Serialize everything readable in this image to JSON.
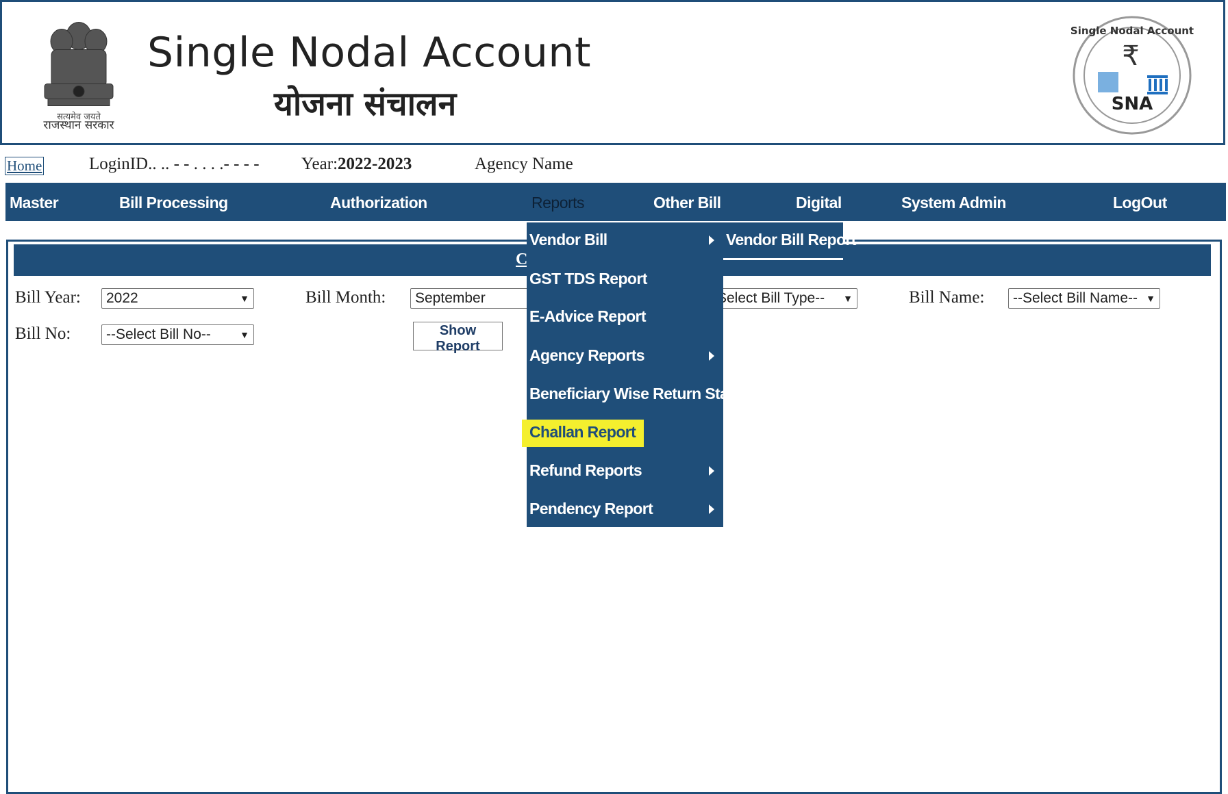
{
  "header": {
    "title_en": "Single Nodal Account",
    "title_hi": "योजना संचालन",
    "emblem_caption": "राजस्थान सरकार",
    "emblem_motto": "सत्यमेव जयते",
    "logo_text": "SNA",
    "logo_ring": "Single Nodal Account"
  },
  "info": {
    "home": "Home",
    "login_label": "LoginID",
    "login_value": ".. .. - - . . . .- - - -",
    "year_label": "Year:",
    "year_value": "2022-2023",
    "agency_label": "Agency Name"
  },
  "nav": {
    "items": [
      "Master",
      "Bill Processing",
      "Authorization",
      "Reports",
      "Other Bill",
      "Digital",
      "System Admin",
      "LogOut"
    ],
    "active": "Reports"
  },
  "reports_menu": {
    "items": [
      {
        "label": "Vendor Bill",
        "has_submenu": true
      },
      {
        "label": "GST TDS Report",
        "has_submenu": false
      },
      {
        "label": "E-Advice Report",
        "has_submenu": false
      },
      {
        "label": "Agency Reports",
        "has_submenu": true
      },
      {
        "label": "Beneficiary Wise Return Status",
        "has_submenu": false
      },
      {
        "label": "Challan Report",
        "has_submenu": false,
        "highlighted": true
      },
      {
        "label": "Refund Reports",
        "has_submenu": true
      },
      {
        "label": "Pendency Report",
        "has_submenu": true
      }
    ],
    "submenu": {
      "label": "Vendor Bill Report"
    }
  },
  "panel": {
    "title": "C",
    "bill_year_label": "Bill Year:",
    "bill_year_value": "2022",
    "bill_month_label": "Bill Month:",
    "bill_month_value": "September",
    "bill_type_value": "Select Bill Type--",
    "bill_name_label": "Bill Name:",
    "bill_name_value": "--Select Bill Name--",
    "bill_no_label": "Bill No:",
    "bill_no_value": "--Select Bill No--",
    "show_report": "Show Report"
  },
  "colors": {
    "nav_bg": "#1f4e79",
    "highlight": "#f4ef2e"
  }
}
